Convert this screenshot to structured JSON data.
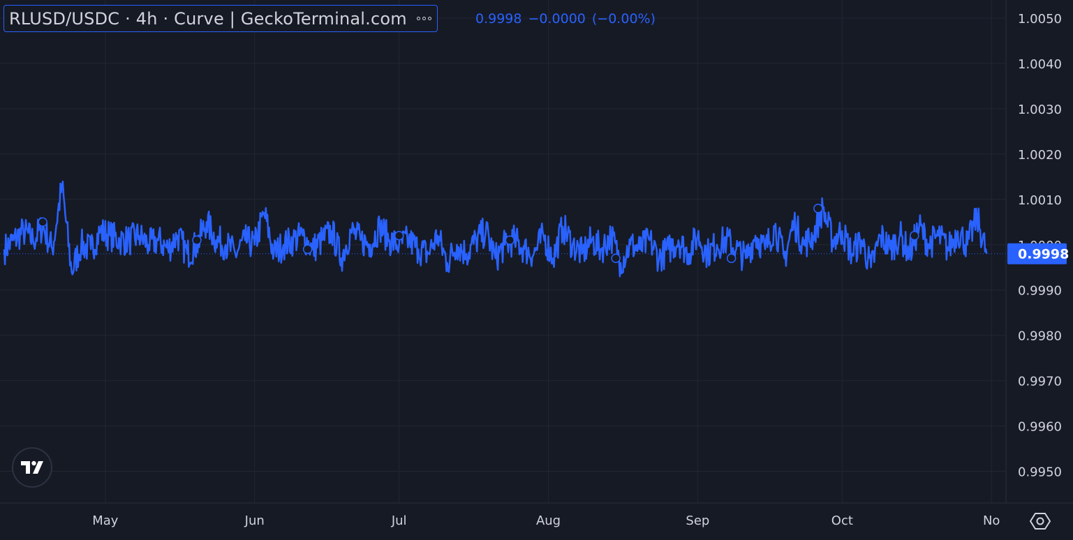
{
  "header": {
    "title": "RLUSD/USDC · 4h · Curve | GeckoTerminal.com",
    "more_icon": "more-dots-icon",
    "price": "0.9998",
    "change": "−0.0000",
    "change_pct": "(−0.00%)"
  },
  "colors": {
    "background": "#161a25",
    "line": "#2962ff",
    "grid": "#232632",
    "axis_text": "#d1d4dc",
    "last_price_bg": "#2962ff"
  },
  "chart_data": {
    "type": "line",
    "title": "RLUSD/USDC · 4h · Curve",
    "ylim": [
      0.9943,
      1.0054
    ],
    "y_ticks": [
      "1.0050",
      "1.0040",
      "1.0030",
      "1.0020",
      "1.0010",
      "1.0000",
      "0.9990",
      "0.9980",
      "0.9970",
      "0.9960",
      "0.9950"
    ],
    "x_ticks": [
      "May",
      "Jun",
      "Jul",
      "Aug",
      "Sep",
      "Oct",
      "No"
    ],
    "last_price_label": "0.9998",
    "grid": true,
    "series": [
      {
        "name": "RLUSD/USDC",
        "x": [
          "Apr 10",
          "Apr 12",
          "Apr 14",
          "Apr 16",
          "Apr 18",
          "Apr 20",
          "Apr 22",
          "Apr 24",
          "Apr 26",
          "Apr 28",
          "Apr 30",
          "May 2",
          "May 4",
          "May 6",
          "May 8",
          "May 10",
          "May 12",
          "May 14",
          "May 16",
          "May 18",
          "May 20",
          "May 22",
          "May 24",
          "May 26",
          "May 28",
          "May 30",
          "Jun 1",
          "Jun 3",
          "Jun 5",
          "Jun 7",
          "Jun 9",
          "Jun 11",
          "Jun 13",
          "Jun 15",
          "Jun 17",
          "Jun 19",
          "Jun 21",
          "Jun 23",
          "Jun 25",
          "Jun 27",
          "Jun 29",
          "Jul 1",
          "Jul 3",
          "Jul 5",
          "Jul 7",
          "Jul 9",
          "Jul 11",
          "Jul 13",
          "Jul 15",
          "Jul 17",
          "Jul 19",
          "Jul 21",
          "Jul 23",
          "Jul 25",
          "Jul 27",
          "Jul 29",
          "Jul 31",
          "Aug 2",
          "Aug 4",
          "Aug 6",
          "Aug 8",
          "Aug 10",
          "Aug 12",
          "Aug 14",
          "Aug 16",
          "Aug 18",
          "Aug 20",
          "Aug 22",
          "Aug 24",
          "Aug 26",
          "Aug 28",
          "Aug 30",
          "Sep 1",
          "Sep 3",
          "Sep 5",
          "Sep 7",
          "Sep 9",
          "Sep 11",
          "Sep 13",
          "Sep 15",
          "Sep 17",
          "Sep 19",
          "Sep 21",
          "Sep 23",
          "Sep 25",
          "Sep 27",
          "Sep 29",
          "Oct 1",
          "Oct 3",
          "Oct 5",
          "Oct 7",
          "Oct 9",
          "Oct 11",
          "Oct 13",
          "Oct 15",
          "Oct 17",
          "Oct 19",
          "Oct 21",
          "Oct 23",
          "Oct 25",
          "Oct 27",
          "Oct 29",
          "Oct 31"
        ],
        "values": [
          0.9999,
          1.0001,
          1.0003,
          1.0001,
          1.0004,
          0.9999,
          1.0013,
          0.9994,
          1.0,
          0.9999,
          1.0003,
          1.0002,
          1.0001,
          1.0001,
          1.0002,
          1.0,
          1.0001,
          0.9999,
          1.0002,
          0.9998,
          1.0,
          1.0005,
          1.0001,
          1.0,
          0.9998,
          1.0001,
          1.0,
          1.0007,
          0.9998,
          1.0,
          1.0001,
          1.0002,
          0.9999,
          1.0001,
          1.0003,
          0.9997,
          1.0003,
          1.0001,
          1.0,
          1.0004,
          1.0001,
          1.0,
          1.0001,
          0.9999,
          0.9998,
          1.0002,
          0.9996,
          1.0,
          0.9998,
          1.0001,
          1.0003,
          0.9997,
          1.0,
          1.0001,
          0.9999,
          0.9998,
          1.0002,
          0.9997,
          1.0004,
          1.0,
          0.9998,
          1.0001,
          0.9999,
          1.0002,
          0.9996,
          1.0,
          0.9999,
          1.0001,
          0.9997,
          0.9999,
          1.0001,
          0.9998,
          1.0002,
          0.9998,
          1.0,
          1.0001,
          0.9999,
          0.9997,
          1.0002,
          0.9999,
          1.0004,
          0.9997,
          1.0005,
          1.0,
          1.0002,
          1.0008,
          1.0001,
          1.0003,
          0.9998,
          1.0001,
          0.9995,
          1.0002,
          0.9999,
          1.0002,
          0.9998,
          1.0004,
          1.0,
          1.0002,
          0.9999,
          1.0003,
          1.0,
          1.0006,
          0.9998
        ]
      }
    ],
    "markers": [
      {
        "x": "Apr 18",
        "y": 1.0005
      },
      {
        "x": "May 20",
        "y": 1.0001
      },
      {
        "x": "Jun 12",
        "y": 0.9999
      },
      {
        "x": "Jul 1",
        "y": 1.0002
      },
      {
        "x": "Jul 24",
        "y": 1.0001
      },
      {
        "x": "Aug 15",
        "y": 0.9997
      },
      {
        "x": "Sep 8",
        "y": 0.9997
      },
      {
        "x": "Sep 26",
        "y": 1.0008
      },
      {
        "x": "Oct 16",
        "y": 1.0002
      }
    ]
  },
  "footer": {
    "logo_icon": "tradingview-logo-icon",
    "settings_icon": "settings-icon"
  }
}
